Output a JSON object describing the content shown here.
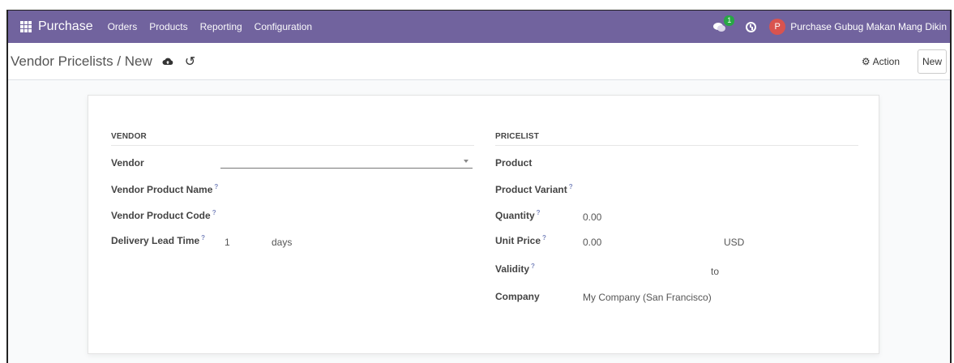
{
  "navbar": {
    "app_name": "Purchase",
    "menu": [
      "Orders",
      "Products",
      "Reporting",
      "Configuration"
    ],
    "chat_badge": "1",
    "user_initial": "P",
    "user_name": "Purchase Gubug Makan Mang Dikin",
    "colors": {
      "navbar_bg": "#71639e",
      "badge": "#28a745",
      "avatar": "#d9534f"
    },
    "icons": [
      "apps-grid-icon",
      "chat-icon",
      "clock-icon"
    ]
  },
  "control_panel": {
    "breadcrumb": "Vendor Pricelists / New",
    "action_label": "Action",
    "new_label": "New",
    "icons": [
      "cloud-upload-icon",
      "undo-icon",
      "gear-icon"
    ]
  },
  "form": {
    "vendor_group": {
      "title": "VENDOR",
      "vendor_label": "Vendor",
      "vendor_value": "",
      "vendor_product_name_label": "Vendor Product Name",
      "vendor_product_code_label": "Vendor Product Code",
      "delivery_lead_time_label": "Delivery Lead Time",
      "delivery_lead_time_value": "1",
      "delivery_lead_time_unit": "days"
    },
    "pricelist_group": {
      "title": "PRICELIST",
      "product_label": "Product",
      "product_variant_label": "Product Variant",
      "quantity_label": "Quantity",
      "quantity_value": "0.00",
      "unit_price_label": "Unit Price",
      "unit_price_value": "0.00",
      "currency": "USD",
      "validity_label": "Validity",
      "validity_separator": "to",
      "company_label": "Company",
      "company_value": "My Company (San Francisco)"
    },
    "help_marker": "?"
  }
}
